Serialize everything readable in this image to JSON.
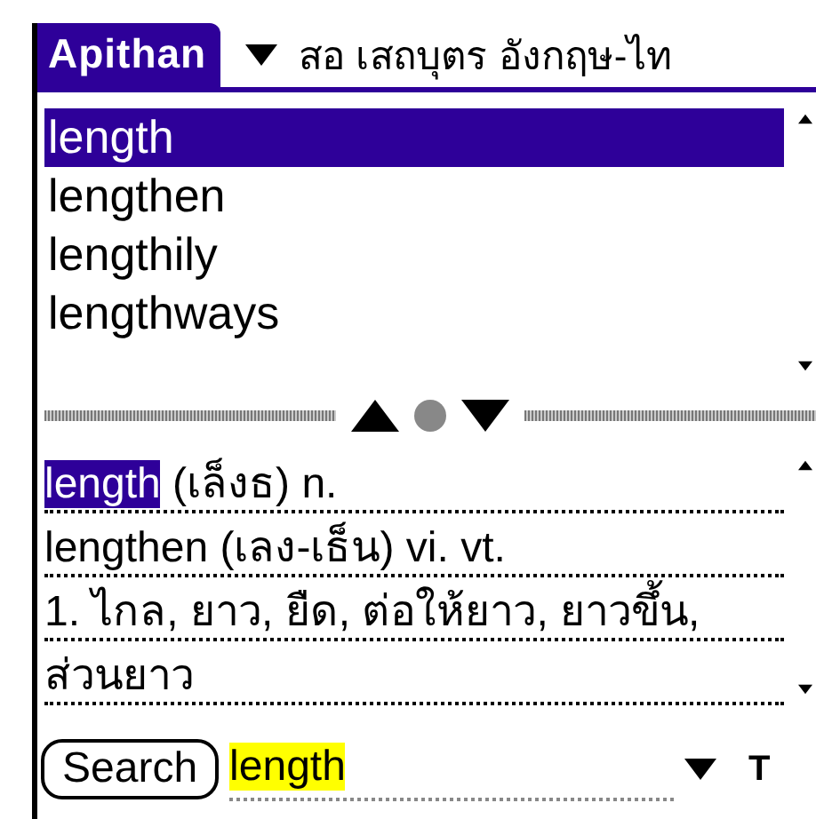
{
  "title": "Apithan",
  "dictionary": {
    "label": "สอ เสถบุตร อังกฤษ-ไท"
  },
  "word_list": [
    {
      "text": "length",
      "selected": true
    },
    {
      "text": "lengthen",
      "selected": false
    },
    {
      "text": "lengthily",
      "selected": false
    },
    {
      "text": "lengthways",
      "selected": false
    }
  ],
  "definition": [
    {
      "segments": [
        {
          "text": "length",
          "highlighted": true
        },
        {
          "text": " (เล็งธ) n.",
          "highlighted": false
        }
      ]
    },
    {
      "segments": [
        {
          "text": "lengthen (เลง-เธ็น) vi. vt.",
          "highlighted": false
        }
      ]
    },
    {
      "segments": [
        {
          "text": "1. ไกล, ยาว, ยืด, ต่อให้ยาว, ยาวขึ้น,",
          "highlighted": false
        }
      ]
    },
    {
      "segments": [
        {
          "text": "ส่วนยาว",
          "highlighted": false
        }
      ]
    }
  ],
  "search": {
    "button": "Search",
    "value": "length",
    "language_label": "T"
  }
}
